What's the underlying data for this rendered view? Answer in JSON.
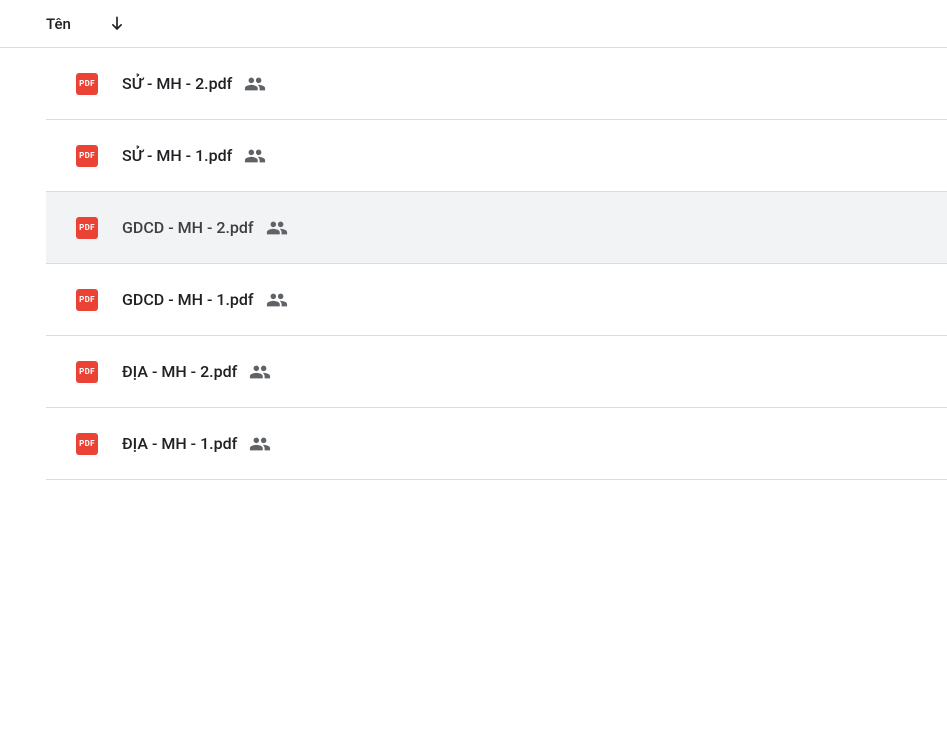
{
  "header": {
    "column_name": "Tên"
  },
  "files": [
    {
      "name": "SỬ - MH - 2.pdf",
      "shared": true,
      "selected": false
    },
    {
      "name": "SỬ - MH - 1.pdf",
      "shared": true,
      "selected": false
    },
    {
      "name": "GDCD - MH - 2.pdf",
      "shared": true,
      "selected": true
    },
    {
      "name": "GDCD - MH - 1.pdf",
      "shared": true,
      "selected": false
    },
    {
      "name": "ĐỊA - MH - 2.pdf",
      "shared": true,
      "selected": false
    },
    {
      "name": "ĐỊA - MH - 1.pdf",
      "shared": true,
      "selected": false
    }
  ],
  "icons": {
    "pdf_label": "PDF"
  }
}
